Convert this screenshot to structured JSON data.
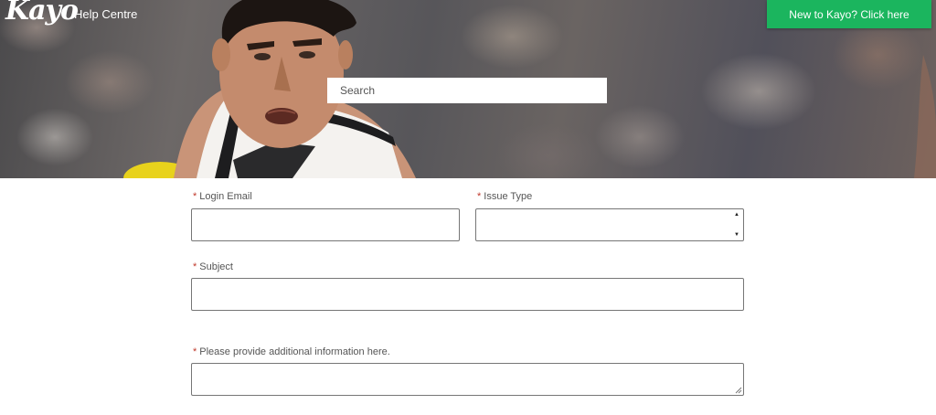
{
  "header": {
    "logo_text": "Kayo",
    "section_title": "Help Centre",
    "new_user_button": "New to Kayo? Click here",
    "accent_color": "#1bb55e"
  },
  "search": {
    "placeholder": "Search"
  },
  "form": {
    "required_marker": "*",
    "login_email": {
      "label": "Login Email",
      "value": ""
    },
    "issue_type": {
      "label": "Issue Type",
      "value": ""
    },
    "subject": {
      "label": "Subject",
      "value": ""
    },
    "additional_info": {
      "label": "Please provide additional information here.",
      "value": ""
    }
  }
}
